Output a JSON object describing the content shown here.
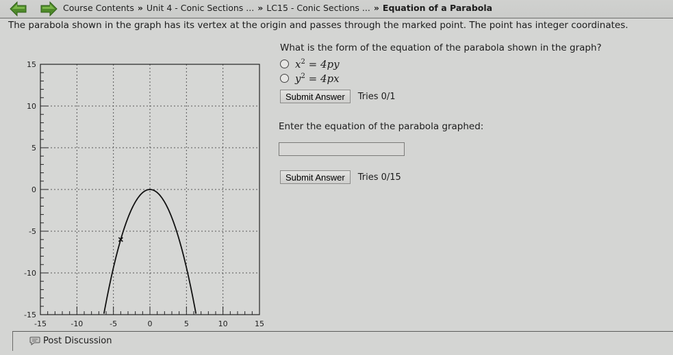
{
  "nav": {
    "back_icon": "left-arrow-icon",
    "forward_icon": "right-arrow-icon",
    "arrow_color": "#4e8a2a"
  },
  "breadcrumb": {
    "items": [
      "Course Contents",
      "Unit 4 - Conic Sections ...",
      "LC15 - Conic Sections ..."
    ],
    "current": "Equation of a Parabola",
    "separator": "»"
  },
  "problem": {
    "statement": "The parabola shown in the graph has its vertex at the origin and passes through the marked point. The point has integer coordinates."
  },
  "question1": {
    "prompt": "What is the form of the equation of the parabola shown in the graph?",
    "choices": [
      {
        "lhs": "x",
        "exp": "2",
        "rhs": " = 4py",
        "selected": false
      },
      {
        "lhs": "y",
        "exp": "2",
        "rhs": " = 4px",
        "selected": false
      }
    ],
    "submit_label": "Submit Answer",
    "tries": "Tries 0/1"
  },
  "question2": {
    "prompt": "Enter the equation of the parabola graphed:",
    "input_value": "",
    "submit_label": "Submit Answer",
    "tries": "Tries 0/15"
  },
  "footer": {
    "discussion_label": "Post Discussion",
    "discussion_icon": "speech-bubble-icon"
  },
  "chart_data": {
    "type": "line",
    "title": "",
    "xlabel": "",
    "ylabel": "",
    "xlim": [
      -15,
      15
    ],
    "ylim": [
      -15,
      15
    ],
    "x_ticks": [
      "-15",
      "-10",
      "-5",
      "0",
      "5",
      "10",
      "15"
    ],
    "y_ticks": [
      "15",
      "10",
      "5",
      "0",
      "-5",
      "-10",
      "-15"
    ],
    "x_tick_values": [
      -15,
      -10,
      -5,
      0,
      5,
      10,
      15
    ],
    "y_tick_values": [
      15,
      10,
      5,
      0,
      -5,
      -10,
      -15
    ],
    "grid": true,
    "minor_ticks_per_major": 5,
    "series": [
      {
        "name": "parabola",
        "equation": "x^2 = -(8/3) y",
        "vertex": [
          0,
          0
        ],
        "opens": "down",
        "x_range": [
          -6.3,
          6.3
        ]
      }
    ],
    "marked_point": [
      -4,
      -6
    ]
  }
}
